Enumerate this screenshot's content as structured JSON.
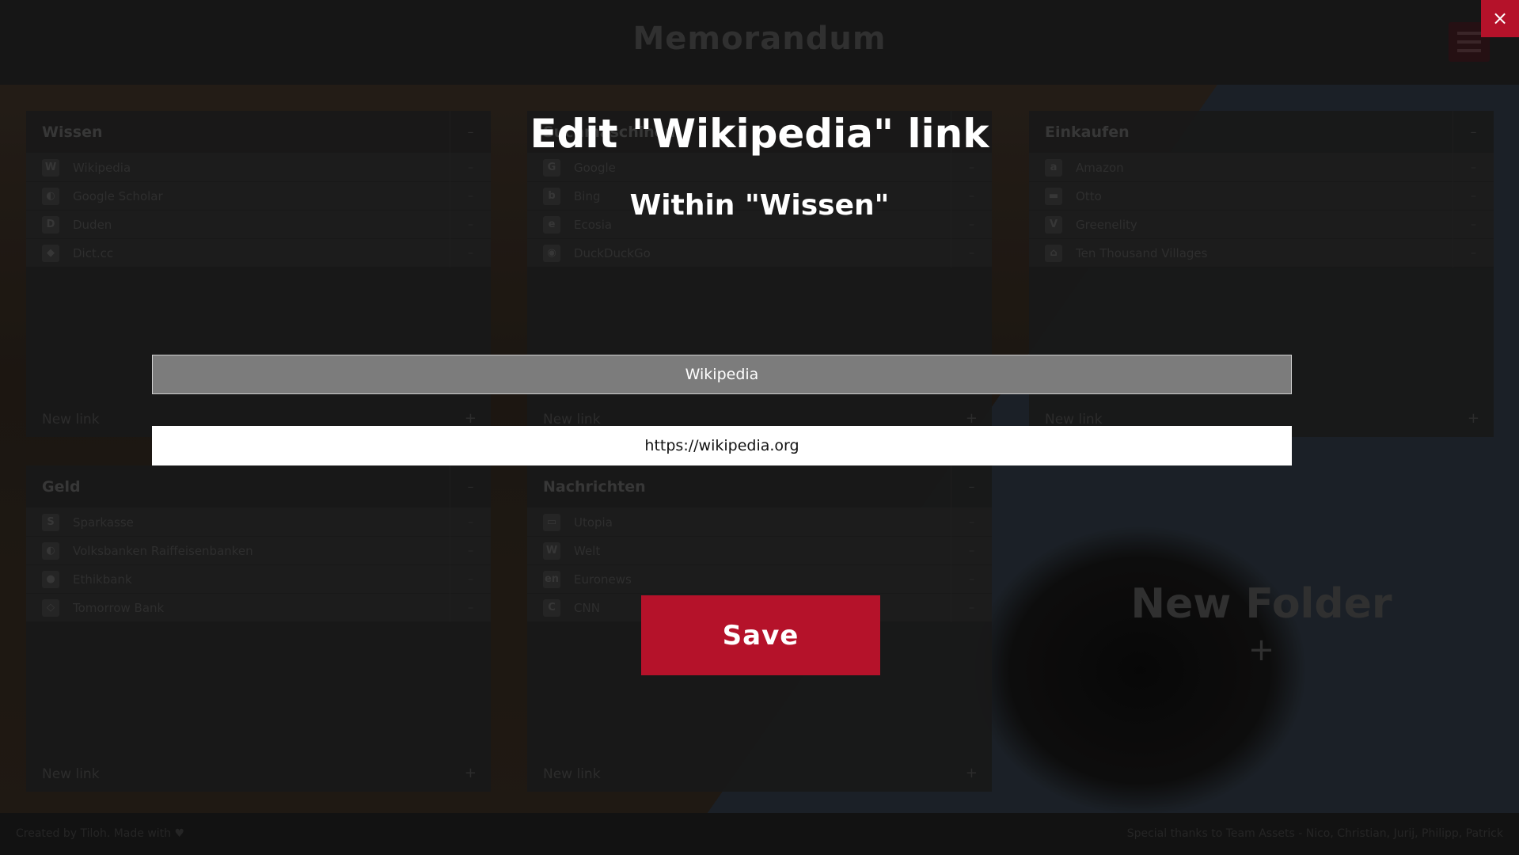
{
  "app": {
    "title": "Memorandum",
    "menu_icon": "hamburger-menu-icon"
  },
  "folders": [
    {
      "name": "Wissen",
      "links": [
        {
          "name": "Wikipedia",
          "icon": "W"
        },
        {
          "name": "Google Scholar",
          "icon": "◐"
        },
        {
          "name": "Duden",
          "icon": "D"
        },
        {
          "name": "Dict.cc",
          "icon": "◆"
        }
      ],
      "new_link": "New link"
    },
    {
      "name": "Suchmaschinen",
      "links": [
        {
          "name": "Google",
          "icon": "G"
        },
        {
          "name": "Bing",
          "icon": "b"
        },
        {
          "name": "Ecosia",
          "icon": "e"
        },
        {
          "name": "DuckDuckGo",
          "icon": "◉"
        }
      ],
      "new_link": "New link"
    },
    {
      "name": "Einkaufen",
      "links": [
        {
          "name": "Amazon",
          "icon": "a"
        },
        {
          "name": "Otto",
          "icon": "▬"
        },
        {
          "name": "Greenelity",
          "icon": "V"
        },
        {
          "name": "Ten Thousand Villages",
          "icon": "⌂"
        }
      ],
      "new_link": "New link"
    },
    {
      "name": "Geld",
      "links": [
        {
          "name": "Sparkasse",
          "icon": "S"
        },
        {
          "name": "Volksbanken Raiffeisenbanken",
          "icon": "◐"
        },
        {
          "name": "Ethikbank",
          "icon": "●"
        },
        {
          "name": "Tomorrow Bank",
          "icon": "◇"
        }
      ],
      "new_link": "New link"
    },
    {
      "name": "Nachrichten",
      "links": [
        {
          "name": "Utopia",
          "icon": "▭"
        },
        {
          "name": "Welt",
          "icon": "W"
        },
        {
          "name": "Euronews",
          "icon": "en"
        },
        {
          "name": "CNN",
          "icon": "C"
        }
      ],
      "new_link": "New link"
    }
  ],
  "new_folder": {
    "label": "New Folder",
    "plus": "+"
  },
  "footer": {
    "left": "Created by Tiloh. Made with ♥",
    "right": "Special thanks to Team Assets - Nico, Christian, Jurij, Philipp, Patrick"
  },
  "modal": {
    "close_label": "×",
    "title": "Edit \"Wikipedia\" link",
    "subtitle": "Within \"Wissen\"",
    "name_value": "Wikipedia",
    "url_value": "https://wikipedia.org",
    "save_label": "Save"
  },
  "colors": {
    "accent": "#b5122a",
    "name_field_bg": "#7c7c7c",
    "url_field_bg": "#ffffff"
  }
}
